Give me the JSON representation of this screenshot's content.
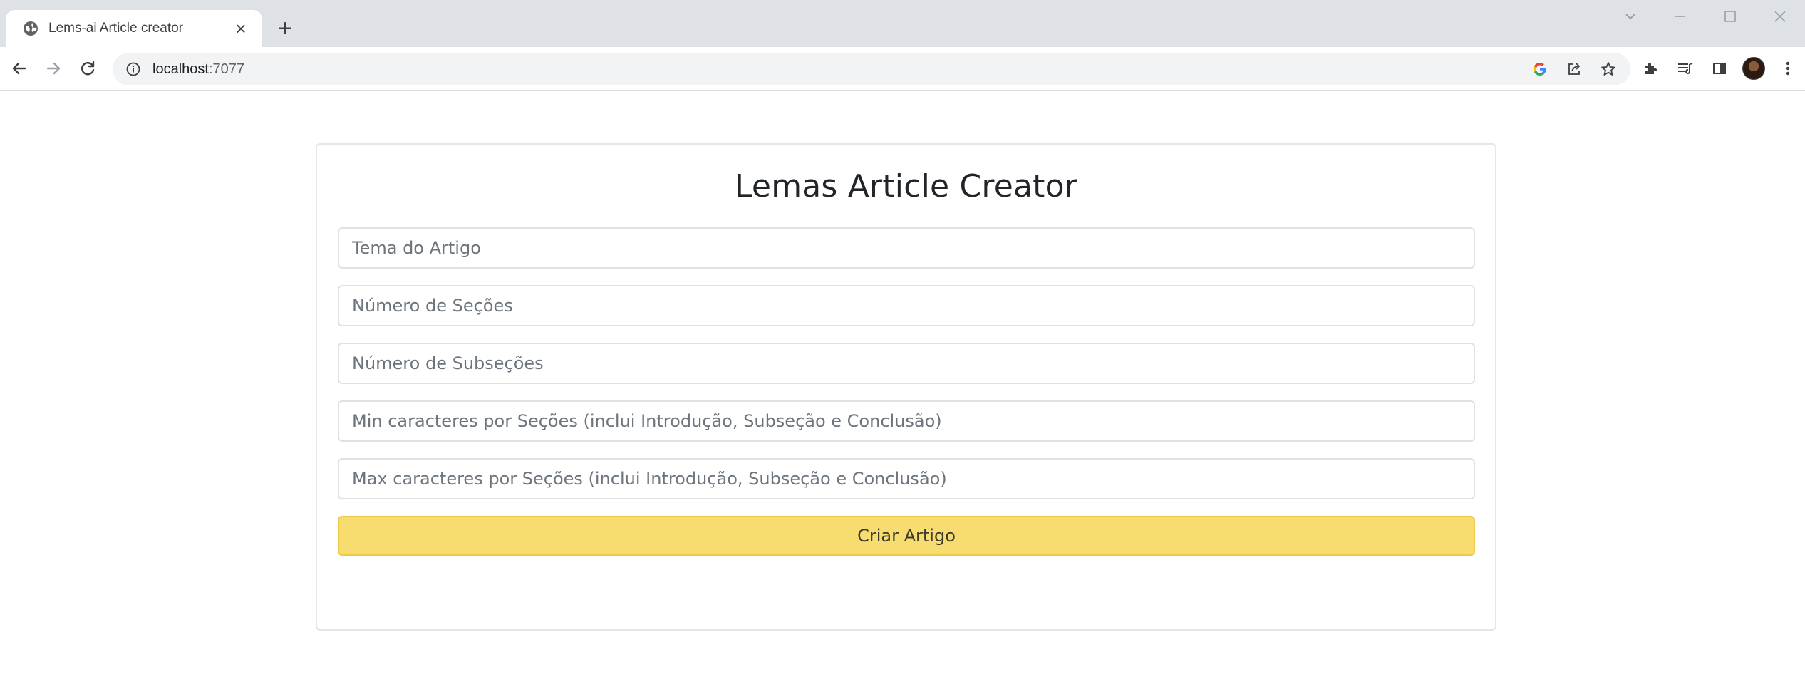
{
  "browser": {
    "tab": {
      "title": "Lems-ai Article creator",
      "favicon": "globe-icon",
      "close_glyph": "×"
    },
    "new_tab_glyph": "+",
    "window_controls": {
      "search_tabs": "⌄",
      "minimize": "—",
      "maximize": "☐",
      "close": "✕"
    },
    "address_bar": {
      "host": "localhost",
      "port": ":7077"
    },
    "icons": {
      "back": "arrow-left-icon",
      "forward": "arrow-right-icon",
      "reload": "reload-icon",
      "site_info": "info-icon",
      "google": "google-icon",
      "share": "share-icon",
      "bookmark": "star-icon",
      "extensions": "puzzle-icon",
      "media": "media-queue-icon",
      "side_panel": "side-panel-icon",
      "menu": "kebab-menu-icon"
    }
  },
  "page": {
    "title": "Lemas Article Creator",
    "form": {
      "fields": [
        {
          "name": "tema",
          "value": "",
          "placeholder": "Tema do Artigo"
        },
        {
          "name": "secoes",
          "value": "",
          "placeholder": "Número de Seções"
        },
        {
          "name": "subsecoes",
          "value": "",
          "placeholder": "Número de Subseções"
        },
        {
          "name": "min_caracteres",
          "value": "",
          "placeholder": "Min caracteres por Seções (inclui Introdução, Subseção e Conclusão)"
        },
        {
          "name": "max_caracteres",
          "value": "",
          "placeholder": "Max caracteres por Seções (inclui Introdução, Subseção e Conclusão)"
        }
      ],
      "submit_label": "Criar Artigo"
    }
  },
  "colors": {
    "button_bg": "#f7dc6f",
    "button_border": "#f1c94a",
    "tabstrip_bg": "#dee1e6",
    "omnibox_bg": "#f1f3f4"
  }
}
